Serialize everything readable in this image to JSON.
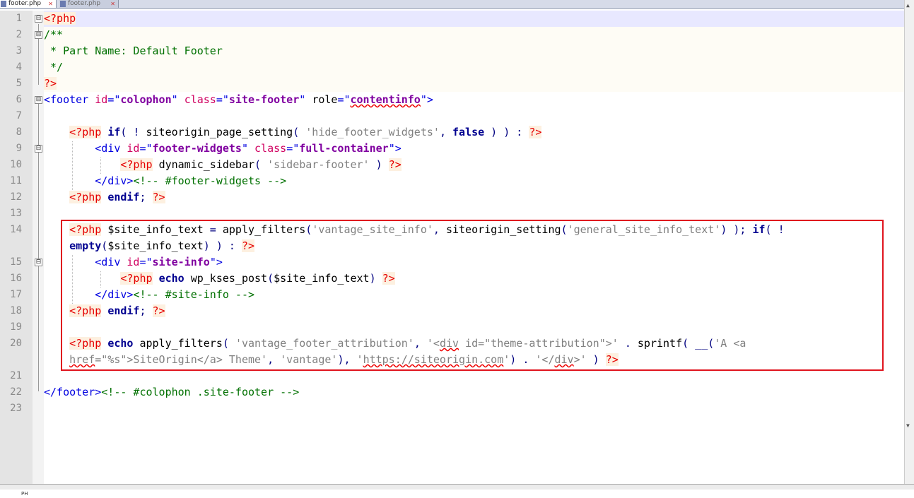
{
  "tabs": [
    {
      "label": "footer.php",
      "active": true
    },
    {
      "label": "footer.php",
      "active": false
    }
  ],
  "tab_close_glyph": "✕",
  "lines": [
    {
      "n": "1",
      "tokens": [
        [
          "php",
          "<?php"
        ]
      ]
    },
    {
      "n": "2",
      "tokens": [
        [
          "cmt",
          "/**"
        ]
      ]
    },
    {
      "n": "3",
      "tokens": [
        [
          "cmt",
          " * Part Name: Default Footer"
        ]
      ]
    },
    {
      "n": "4",
      "tokens": [
        [
          "cmt",
          " */"
        ]
      ]
    },
    {
      "n": "5",
      "tokens": [
        [
          "php",
          "?>"
        ]
      ]
    },
    {
      "n": "6",
      "tokens": [
        [
          "tag",
          "<footer "
        ],
        [
          "attr",
          "id"
        ],
        [
          "tag",
          "=\""
        ],
        [
          "val",
          "colophon"
        ],
        [
          "tag",
          "\" "
        ],
        [
          "attr",
          "class"
        ],
        [
          "tag",
          "=\""
        ],
        [
          "val",
          "site-footer"
        ],
        [
          "tag",
          "\" "
        ],
        [
          "txt",
          "role"
        ],
        [
          "tag",
          "=\""
        ],
        [
          "valsq",
          "contentinfo"
        ],
        [
          "tag",
          "\">"
        ]
      ]
    },
    {
      "n": "7",
      "tokens": []
    },
    {
      "n": "8",
      "tokens": [
        [
          "sp",
          "    "
        ],
        [
          "php",
          "<?php"
        ],
        [
          "sp",
          " "
        ],
        [
          "kw",
          "if"
        ],
        [
          "op",
          "( ! "
        ],
        [
          "txt",
          "siteorigin_page_setting"
        ],
        [
          "op",
          "( "
        ],
        [
          "str",
          "'hide_footer_widgets'"
        ],
        [
          "op",
          ", "
        ],
        [
          "kw",
          "false"
        ],
        [
          "op",
          " ) ) : "
        ],
        [
          "php",
          "?>"
        ]
      ]
    },
    {
      "n": "9",
      "tokens": [
        [
          "sp",
          "        "
        ],
        [
          "tag",
          "<div "
        ],
        [
          "attr",
          "id"
        ],
        [
          "tag",
          "=\""
        ],
        [
          "val",
          "footer-widgets"
        ],
        [
          "tag",
          "\" "
        ],
        [
          "attr",
          "class"
        ],
        [
          "tag",
          "=\""
        ],
        [
          "val",
          "full-container"
        ],
        [
          "tag",
          "\">"
        ]
      ]
    },
    {
      "n": "10",
      "tokens": [
        [
          "sp",
          "            "
        ],
        [
          "php",
          "<?php"
        ],
        [
          "sp",
          " "
        ],
        [
          "txt",
          "dynamic_sidebar"
        ],
        [
          "op",
          "( "
        ],
        [
          "str",
          "'sidebar-footer'"
        ],
        [
          "op",
          " ) "
        ],
        [
          "php",
          "?>"
        ]
      ]
    },
    {
      "n": "11",
      "tokens": [
        [
          "sp",
          "        "
        ],
        [
          "tag",
          "</div>"
        ],
        [
          "cmt",
          "<!-- #footer-widgets -->"
        ]
      ]
    },
    {
      "n": "12",
      "tokens": [
        [
          "sp",
          "    "
        ],
        [
          "php",
          "<?php"
        ],
        [
          "sp",
          " "
        ],
        [
          "kw",
          "endif"
        ],
        [
          "op",
          "; "
        ],
        [
          "php",
          "?>"
        ]
      ]
    },
    {
      "n": "13",
      "tokens": []
    },
    {
      "n": "14",
      "tokens": [
        [
          "sp",
          "    "
        ],
        [
          "php",
          "<?php"
        ],
        [
          "sp",
          " "
        ],
        [
          "txt",
          "$site_info_text"
        ],
        [
          "op",
          " = "
        ],
        [
          "txt",
          "apply_filters"
        ],
        [
          "op",
          "("
        ],
        [
          "str",
          "'vantage_site_info'"
        ],
        [
          "op",
          ", "
        ],
        [
          "txt",
          "siteorigin_setting"
        ],
        [
          "op",
          "("
        ],
        [
          "str",
          "'general_site_info_text'"
        ],
        [
          "op",
          ") ); "
        ],
        [
          "kw",
          "if"
        ],
        [
          "op",
          "( !"
        ]
      ]
    },
    {
      "n": "",
      "tokens": [
        [
          "kwi",
          "    empty"
        ],
        [
          "op",
          "("
        ],
        [
          "txt",
          "$site_info_text"
        ],
        [
          "op",
          ") ) : "
        ],
        [
          "php",
          "?>"
        ]
      ]
    },
    {
      "n": "15",
      "tokens": [
        [
          "sp",
          "        "
        ],
        [
          "tag",
          "<div "
        ],
        [
          "attr",
          "id"
        ],
        [
          "tag",
          "=\""
        ],
        [
          "val",
          "site-info"
        ],
        [
          "tag",
          "\">"
        ]
      ]
    },
    {
      "n": "16",
      "tokens": [
        [
          "sp",
          "            "
        ],
        [
          "php",
          "<?php"
        ],
        [
          "sp",
          " "
        ],
        [
          "kw",
          "echo"
        ],
        [
          "sp",
          " "
        ],
        [
          "txt",
          "wp_kses_post"
        ],
        [
          "op",
          "("
        ],
        [
          "txt",
          "$site_info_text"
        ],
        [
          "op",
          ") "
        ],
        [
          "php",
          "?>"
        ]
      ]
    },
    {
      "n": "17",
      "tokens": [
        [
          "sp",
          "        "
        ],
        [
          "tag",
          "</div>"
        ],
        [
          "cmt",
          "<!-- #site-info -->"
        ]
      ]
    },
    {
      "n": "18",
      "tokens": [
        [
          "sp",
          "    "
        ],
        [
          "php",
          "<?php"
        ],
        [
          "sp",
          " "
        ],
        [
          "kw",
          "endif"
        ],
        [
          "op",
          "; "
        ],
        [
          "php",
          "?>"
        ]
      ]
    },
    {
      "n": "19",
      "tokens": []
    },
    {
      "n": "20",
      "tokens": [
        [
          "sp",
          "    "
        ],
        [
          "php",
          "<?php"
        ],
        [
          "sp",
          " "
        ],
        [
          "kw",
          "echo"
        ],
        [
          "sp",
          " "
        ],
        [
          "txt",
          "apply_filters"
        ],
        [
          "op",
          "( "
        ],
        [
          "str",
          "'vantage_footer_attribution'"
        ],
        [
          "op",
          ", "
        ],
        [
          "str",
          "'<"
        ],
        [
          "strsq",
          "div"
        ],
        [
          "str",
          " id=\"theme-attribution\">'"
        ],
        [
          "op",
          " . "
        ],
        [
          "txt",
          "sprintf"
        ],
        [
          "op",
          "( __("
        ],
        [
          "str",
          "'A <a"
        ]
      ]
    },
    {
      "n": "",
      "tokens": [
        [
          "sp",
          "    "
        ],
        [
          "strsq",
          "href"
        ],
        [
          "str",
          "=\"%s\">SiteOrigin</a> Theme'"
        ],
        [
          "op",
          ", "
        ],
        [
          "str",
          "'vantage'"
        ],
        [
          "op",
          "), "
        ],
        [
          "str",
          "'"
        ],
        [
          "strsq",
          "https://siteorigin.com"
        ],
        [
          "str",
          "'"
        ],
        [
          "op",
          ") . "
        ],
        [
          "str",
          "'</"
        ],
        [
          "strsq",
          "div"
        ],
        [
          "str",
          ">'"
        ],
        [
          "op",
          " ) "
        ],
        [
          "php",
          "?>"
        ]
      ]
    },
    {
      "n": "21",
      "tokens": []
    },
    {
      "n": "22",
      "tokens": [
        [
          "tag",
          "</footer>"
        ],
        [
          "cmt",
          "<!-- #colophon .site-footer -->"
        ]
      ]
    },
    {
      "n": "23",
      "tokens": []
    }
  ],
  "fold_markers": [
    "⊟",
    "⊟",
    "⊟",
    "⊟",
    "⊟",
    "⊟"
  ],
  "scroll_up": "▲",
  "scroll_down": "▼",
  "status_text": "PH"
}
